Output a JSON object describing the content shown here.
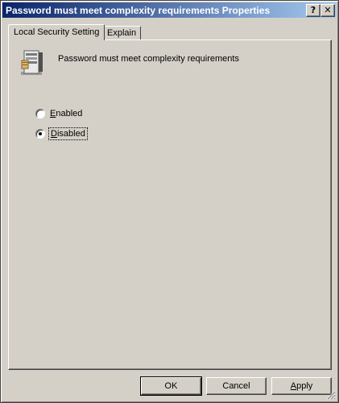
{
  "window": {
    "title": "Password must meet complexity requirements Properties",
    "help_button": "?",
    "close_button": "✕"
  },
  "tabs": [
    {
      "label": "Local Security Setting",
      "active": true
    },
    {
      "label": "Explain",
      "active": false
    }
  ],
  "policy": {
    "icon": "server-policy-icon",
    "name": "Password must meet complexity requirements"
  },
  "options": [
    {
      "label": "Enabled",
      "accel": "E",
      "rest": "nabled",
      "selected": false
    },
    {
      "label": "Disabled",
      "accel": "D",
      "rest": "isabled",
      "selected": true
    }
  ],
  "buttons": {
    "ok": "OK",
    "cancel": "Cancel",
    "apply_accel": "A",
    "apply_rest": "pply"
  },
  "colors": {
    "title_gradient_start": "#0a246a",
    "title_gradient_end": "#a6caf0",
    "face": "#d4d0c8"
  }
}
